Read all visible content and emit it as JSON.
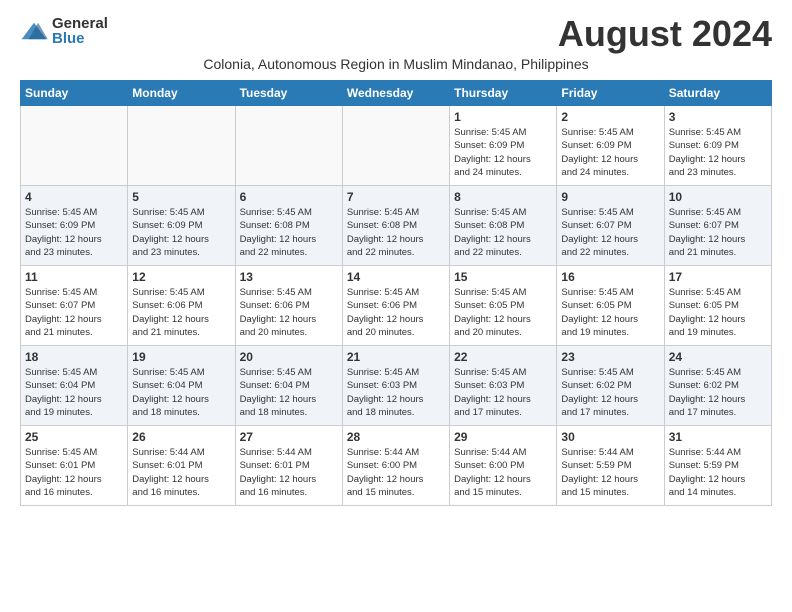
{
  "header": {
    "logo_general": "General",
    "logo_blue": "Blue",
    "month_year": "August 2024",
    "subtitle": "Colonia, Autonomous Region in Muslim Mindanao, Philippines"
  },
  "weekdays": [
    "Sunday",
    "Monday",
    "Tuesday",
    "Wednesday",
    "Thursday",
    "Friday",
    "Saturday"
  ],
  "weeks": [
    [
      {
        "day": "",
        "info": ""
      },
      {
        "day": "",
        "info": ""
      },
      {
        "day": "",
        "info": ""
      },
      {
        "day": "",
        "info": ""
      },
      {
        "day": "1",
        "info": "Sunrise: 5:45 AM\nSunset: 6:09 PM\nDaylight: 12 hours\nand 24 minutes."
      },
      {
        "day": "2",
        "info": "Sunrise: 5:45 AM\nSunset: 6:09 PM\nDaylight: 12 hours\nand 24 minutes."
      },
      {
        "day": "3",
        "info": "Sunrise: 5:45 AM\nSunset: 6:09 PM\nDaylight: 12 hours\nand 23 minutes."
      }
    ],
    [
      {
        "day": "4",
        "info": "Sunrise: 5:45 AM\nSunset: 6:09 PM\nDaylight: 12 hours\nand 23 minutes."
      },
      {
        "day": "5",
        "info": "Sunrise: 5:45 AM\nSunset: 6:09 PM\nDaylight: 12 hours\nand 23 minutes."
      },
      {
        "day": "6",
        "info": "Sunrise: 5:45 AM\nSunset: 6:08 PM\nDaylight: 12 hours\nand 22 minutes."
      },
      {
        "day": "7",
        "info": "Sunrise: 5:45 AM\nSunset: 6:08 PM\nDaylight: 12 hours\nand 22 minutes."
      },
      {
        "day": "8",
        "info": "Sunrise: 5:45 AM\nSunset: 6:08 PM\nDaylight: 12 hours\nand 22 minutes."
      },
      {
        "day": "9",
        "info": "Sunrise: 5:45 AM\nSunset: 6:07 PM\nDaylight: 12 hours\nand 22 minutes."
      },
      {
        "day": "10",
        "info": "Sunrise: 5:45 AM\nSunset: 6:07 PM\nDaylight: 12 hours\nand 21 minutes."
      }
    ],
    [
      {
        "day": "11",
        "info": "Sunrise: 5:45 AM\nSunset: 6:07 PM\nDaylight: 12 hours\nand 21 minutes."
      },
      {
        "day": "12",
        "info": "Sunrise: 5:45 AM\nSunset: 6:06 PM\nDaylight: 12 hours\nand 21 minutes."
      },
      {
        "day": "13",
        "info": "Sunrise: 5:45 AM\nSunset: 6:06 PM\nDaylight: 12 hours\nand 20 minutes."
      },
      {
        "day": "14",
        "info": "Sunrise: 5:45 AM\nSunset: 6:06 PM\nDaylight: 12 hours\nand 20 minutes."
      },
      {
        "day": "15",
        "info": "Sunrise: 5:45 AM\nSunset: 6:05 PM\nDaylight: 12 hours\nand 20 minutes."
      },
      {
        "day": "16",
        "info": "Sunrise: 5:45 AM\nSunset: 6:05 PM\nDaylight: 12 hours\nand 19 minutes."
      },
      {
        "day": "17",
        "info": "Sunrise: 5:45 AM\nSunset: 6:05 PM\nDaylight: 12 hours\nand 19 minutes."
      }
    ],
    [
      {
        "day": "18",
        "info": "Sunrise: 5:45 AM\nSunset: 6:04 PM\nDaylight: 12 hours\nand 19 minutes."
      },
      {
        "day": "19",
        "info": "Sunrise: 5:45 AM\nSunset: 6:04 PM\nDaylight: 12 hours\nand 18 minutes."
      },
      {
        "day": "20",
        "info": "Sunrise: 5:45 AM\nSunset: 6:04 PM\nDaylight: 12 hours\nand 18 minutes."
      },
      {
        "day": "21",
        "info": "Sunrise: 5:45 AM\nSunset: 6:03 PM\nDaylight: 12 hours\nand 18 minutes."
      },
      {
        "day": "22",
        "info": "Sunrise: 5:45 AM\nSunset: 6:03 PM\nDaylight: 12 hours\nand 17 minutes."
      },
      {
        "day": "23",
        "info": "Sunrise: 5:45 AM\nSunset: 6:02 PM\nDaylight: 12 hours\nand 17 minutes."
      },
      {
        "day": "24",
        "info": "Sunrise: 5:45 AM\nSunset: 6:02 PM\nDaylight: 12 hours\nand 17 minutes."
      }
    ],
    [
      {
        "day": "25",
        "info": "Sunrise: 5:45 AM\nSunset: 6:01 PM\nDaylight: 12 hours\nand 16 minutes."
      },
      {
        "day": "26",
        "info": "Sunrise: 5:44 AM\nSunset: 6:01 PM\nDaylight: 12 hours\nand 16 minutes."
      },
      {
        "day": "27",
        "info": "Sunrise: 5:44 AM\nSunset: 6:01 PM\nDaylight: 12 hours\nand 16 minutes."
      },
      {
        "day": "28",
        "info": "Sunrise: 5:44 AM\nSunset: 6:00 PM\nDaylight: 12 hours\nand 15 minutes."
      },
      {
        "day": "29",
        "info": "Sunrise: 5:44 AM\nSunset: 6:00 PM\nDaylight: 12 hours\nand 15 minutes."
      },
      {
        "day": "30",
        "info": "Sunrise: 5:44 AM\nSunset: 5:59 PM\nDaylight: 12 hours\nand 15 minutes."
      },
      {
        "day": "31",
        "info": "Sunrise: 5:44 AM\nSunset: 5:59 PM\nDaylight: 12 hours\nand 14 minutes."
      }
    ]
  ]
}
